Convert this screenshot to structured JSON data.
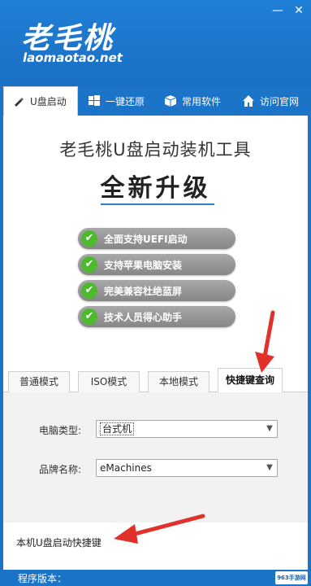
{
  "app": {
    "logo_text": "老毛桃",
    "logo_url": "laomaotao.net"
  },
  "window": {
    "minimize_glyph": "—",
    "close_glyph": "✕"
  },
  "top_tabs": [
    {
      "label": "U盘启动",
      "icon": "usb-icon",
      "active": true
    },
    {
      "label": "一键还原",
      "icon": "windows-icon",
      "active": false
    },
    {
      "label": "常用软件",
      "icon": "box-icon",
      "active": false
    },
    {
      "label": "访问官网",
      "icon": "home-icon",
      "active": false
    }
  ],
  "hero": {
    "title": "老毛桃U盘启动装机工具",
    "upgrade": "全新升级",
    "accent_color": "#2a7fd1"
  },
  "features": [
    {
      "label": "全面支持UEFI启动"
    },
    {
      "label": "支持苹果电脑安装"
    },
    {
      "label": "完美兼容杜绝蓝屏"
    },
    {
      "label": "技术人员得心助手"
    }
  ],
  "mode_tabs": [
    {
      "label": "普通模式",
      "active": false
    },
    {
      "label": "ISO模式",
      "active": false
    },
    {
      "label": "本地模式",
      "active": false
    },
    {
      "label": "快捷键查询",
      "active": true
    }
  ],
  "form": {
    "computer_type_label": "电脑类型:",
    "computer_type_value": "台式机",
    "brand_label": "品牌名称:",
    "brand_value": "eMachines"
  },
  "hotkey_text": "本机U盘启动快捷键",
  "footer": {
    "version": "程序版本：",
    "watermark": "963手游网"
  },
  "colors": {
    "header_blue": "#1c74c9",
    "check_green": "#4dbb2e",
    "arrow_red": "#e0312b"
  }
}
